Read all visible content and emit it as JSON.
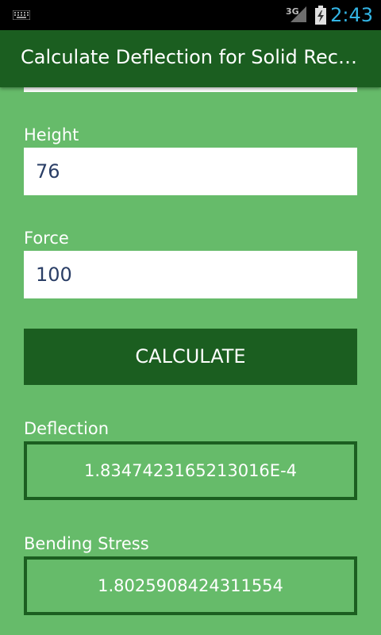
{
  "status_bar": {
    "network": "3G",
    "time": "2:43"
  },
  "app_bar": {
    "title": "Calculate Deflection for Solid Rect…"
  },
  "form": {
    "height_label": "Height",
    "height_value": "76",
    "force_label": "Force",
    "force_value": "100",
    "calculate_label": "CALCULATE"
  },
  "results": {
    "deflection_label": "Deflection",
    "deflection_value": "1.8347423165213016E-4",
    "bending_stress_label": "Bending Stress",
    "bending_stress_value": "1.8025908424311554"
  },
  "colors": {
    "background": "#66bb6a",
    "primary_dark": "#1b5e20",
    "status_clock": "#33b5e5"
  }
}
